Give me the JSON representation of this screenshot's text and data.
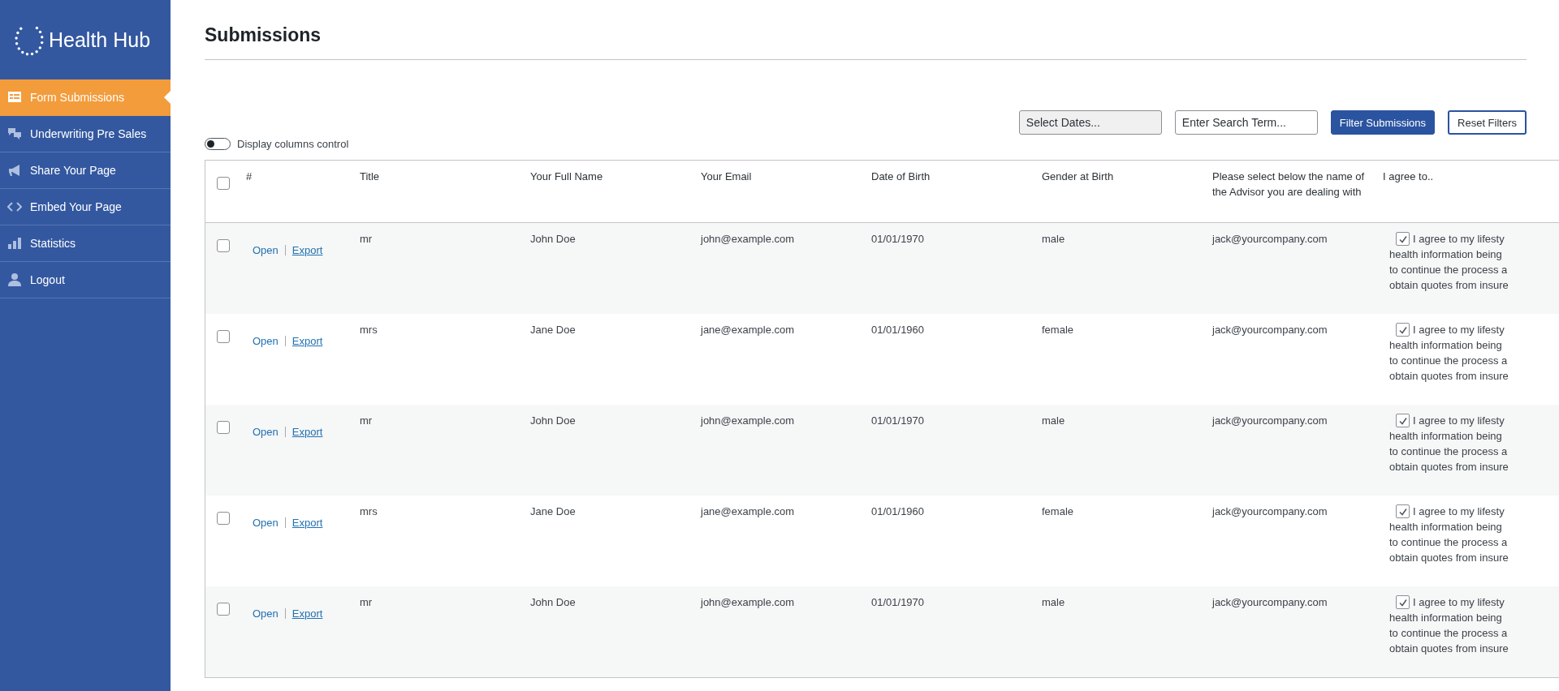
{
  "sidebar": {
    "logo": "Health Hub",
    "items": [
      {
        "label": "Form Submissions",
        "selected": true
      },
      {
        "label": "Underwriting Pre Sales",
        "selected": false
      },
      {
        "label": "Share Your Page",
        "selected": false
      },
      {
        "label": "Embed Your Page",
        "selected": false
      },
      {
        "label": "Statistics",
        "selected": false
      },
      {
        "label": "Logout",
        "selected": false
      }
    ]
  },
  "page": {
    "title": "Submissions"
  },
  "filters": {
    "dates": {
      "placeholder": "Select Dates..."
    },
    "search": {
      "placeholder": "Enter Search Term..."
    },
    "buttons": [
      "Filter Submissions",
      "Reset Filters"
    ]
  },
  "columns_toggle": {
    "label": "Display columns control",
    "on": false
  },
  "table": {
    "all_checked": false,
    "columns": [
      "#",
      "Title",
      "Your Full Name",
      "Your Email",
      "Date of Birth",
      "Gender at Birth",
      "Please select below the name of the Advisor you are dealing with",
      "I agree to.."
    ],
    "rows": [
      {
        "checked": false,
        "actions": [
          "Open",
          "Export"
        ],
        "title": "mr",
        "name": "John Doe",
        "email": "john@example.com",
        "dob": "01/01/1970",
        "gender": "male",
        "advisor": "jack@yourcompany.com",
        "agree_checked": true,
        "agree_lines": [
          "I agree to my lifesty",
          "health information being",
          "to continue the process a",
          "obtain quotes from insure"
        ]
      },
      {
        "checked": false,
        "actions": [
          "Open",
          "Export"
        ],
        "title": "mrs",
        "name": "Jane Doe",
        "email": "jane@example.com",
        "dob": "01/01/1960",
        "gender": "female",
        "advisor": "jack@yourcompany.com",
        "agree_checked": true,
        "agree_lines": [
          "I agree to my lifesty",
          "health information being",
          "to continue the process a",
          "obtain quotes from insure"
        ]
      },
      {
        "checked": false,
        "actions": [
          "Open",
          "Export"
        ],
        "title": "mr",
        "name": "John Doe",
        "email": "john@example.com",
        "dob": "01/01/1970",
        "gender": "male",
        "advisor": "jack@yourcompany.com",
        "agree_checked": true,
        "agree_lines": [
          "I agree to my lifesty",
          "health information being",
          "to continue the process a",
          "obtain quotes from insure"
        ]
      },
      {
        "checked": false,
        "actions": [
          "Open",
          "Export"
        ],
        "title": "mrs",
        "name": "Jane Doe",
        "email": "jane@example.com",
        "dob": "01/01/1960",
        "gender": "female",
        "advisor": "jack@yourcompany.com",
        "agree_checked": true,
        "agree_lines": [
          "I agree to my lifesty",
          "health information being",
          "to continue the process a",
          "obtain quotes from insure"
        ]
      },
      {
        "checked": false,
        "actions": [
          "Open",
          "Export"
        ],
        "title": "mr",
        "name": "John Doe",
        "email": "john@example.com",
        "dob": "01/01/1970",
        "gender": "male",
        "advisor": "jack@yourcompany.com",
        "agree_checked": true,
        "agree_lines": [
          "I agree to my lifesty",
          "health information being",
          "to continue the process a",
          "obtain quotes from insure"
        ]
      }
    ]
  }
}
